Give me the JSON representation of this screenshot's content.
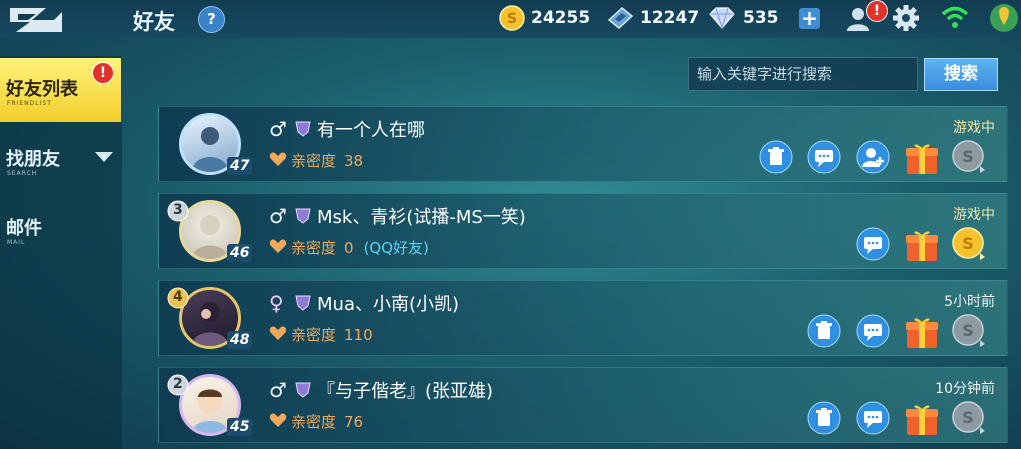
{
  "topbar": {
    "title": "好友",
    "help_label": "?",
    "gold": "24255",
    "vouchers": "12247",
    "diamonds": "535",
    "add_label": "+",
    "notification_badge": "!"
  },
  "sidebar": {
    "items": [
      {
        "label": "好友列表",
        "sub": "FRIENDLIST",
        "badge": "!"
      },
      {
        "label": "找朋友",
        "sub": "SEARCH"
      },
      {
        "label": "邮件",
        "sub": "MAIL"
      }
    ]
  },
  "search": {
    "placeholder": "输入关键字进行搜索",
    "button_label": "搜索"
  },
  "friends": [
    {
      "level": "47",
      "rank": "",
      "gender": "♂",
      "name": "有一个人在哪",
      "intimacy_label": "亲密度",
      "intimacy": "38",
      "tag": "",
      "status": "游戏中",
      "status_type": "playing",
      "actions": [
        "delete-button",
        "chat-button",
        "invite-button",
        "gift-button",
        "coin-button-gray"
      ]
    },
    {
      "level": "46",
      "rank": "3",
      "gender": "♂",
      "name": "Msk、青衫(试播-MS一笑)",
      "intimacy_label": "亲密度",
      "intimacy": "0",
      "tag": "(QQ好友)",
      "status": "游戏中",
      "status_type": "playing",
      "actions": [
        "chat-button",
        "gift-button",
        "coin-button-gold"
      ]
    },
    {
      "level": "48",
      "rank": "4",
      "gender": "♀",
      "name": "Mua、小南(小凯)",
      "intimacy_label": "亲密度",
      "intimacy": "110",
      "tag": "",
      "status": "5小时前",
      "status_type": "time",
      "actions": [
        "delete-button",
        "chat-button",
        "gift-button",
        "coin-button-gray"
      ]
    },
    {
      "level": "45",
      "rank": "2",
      "gender": "♂",
      "name": "『与子偕老』(张亚雄)",
      "intimacy_label": "亲密度",
      "intimacy": "76",
      "tag": "",
      "status": "10分钟前",
      "status_type": "time",
      "actions": [
        "delete-button",
        "chat-button",
        "gift-button",
        "coin-button-gray"
      ]
    }
  ],
  "colors": {
    "accent_yellow": "#f3cf2b",
    "button_blue": "#3b8ddc",
    "status_playing": "#f5e6a8",
    "intimacy": "#f0a85a",
    "qq_tag": "#5fd0ee"
  }
}
